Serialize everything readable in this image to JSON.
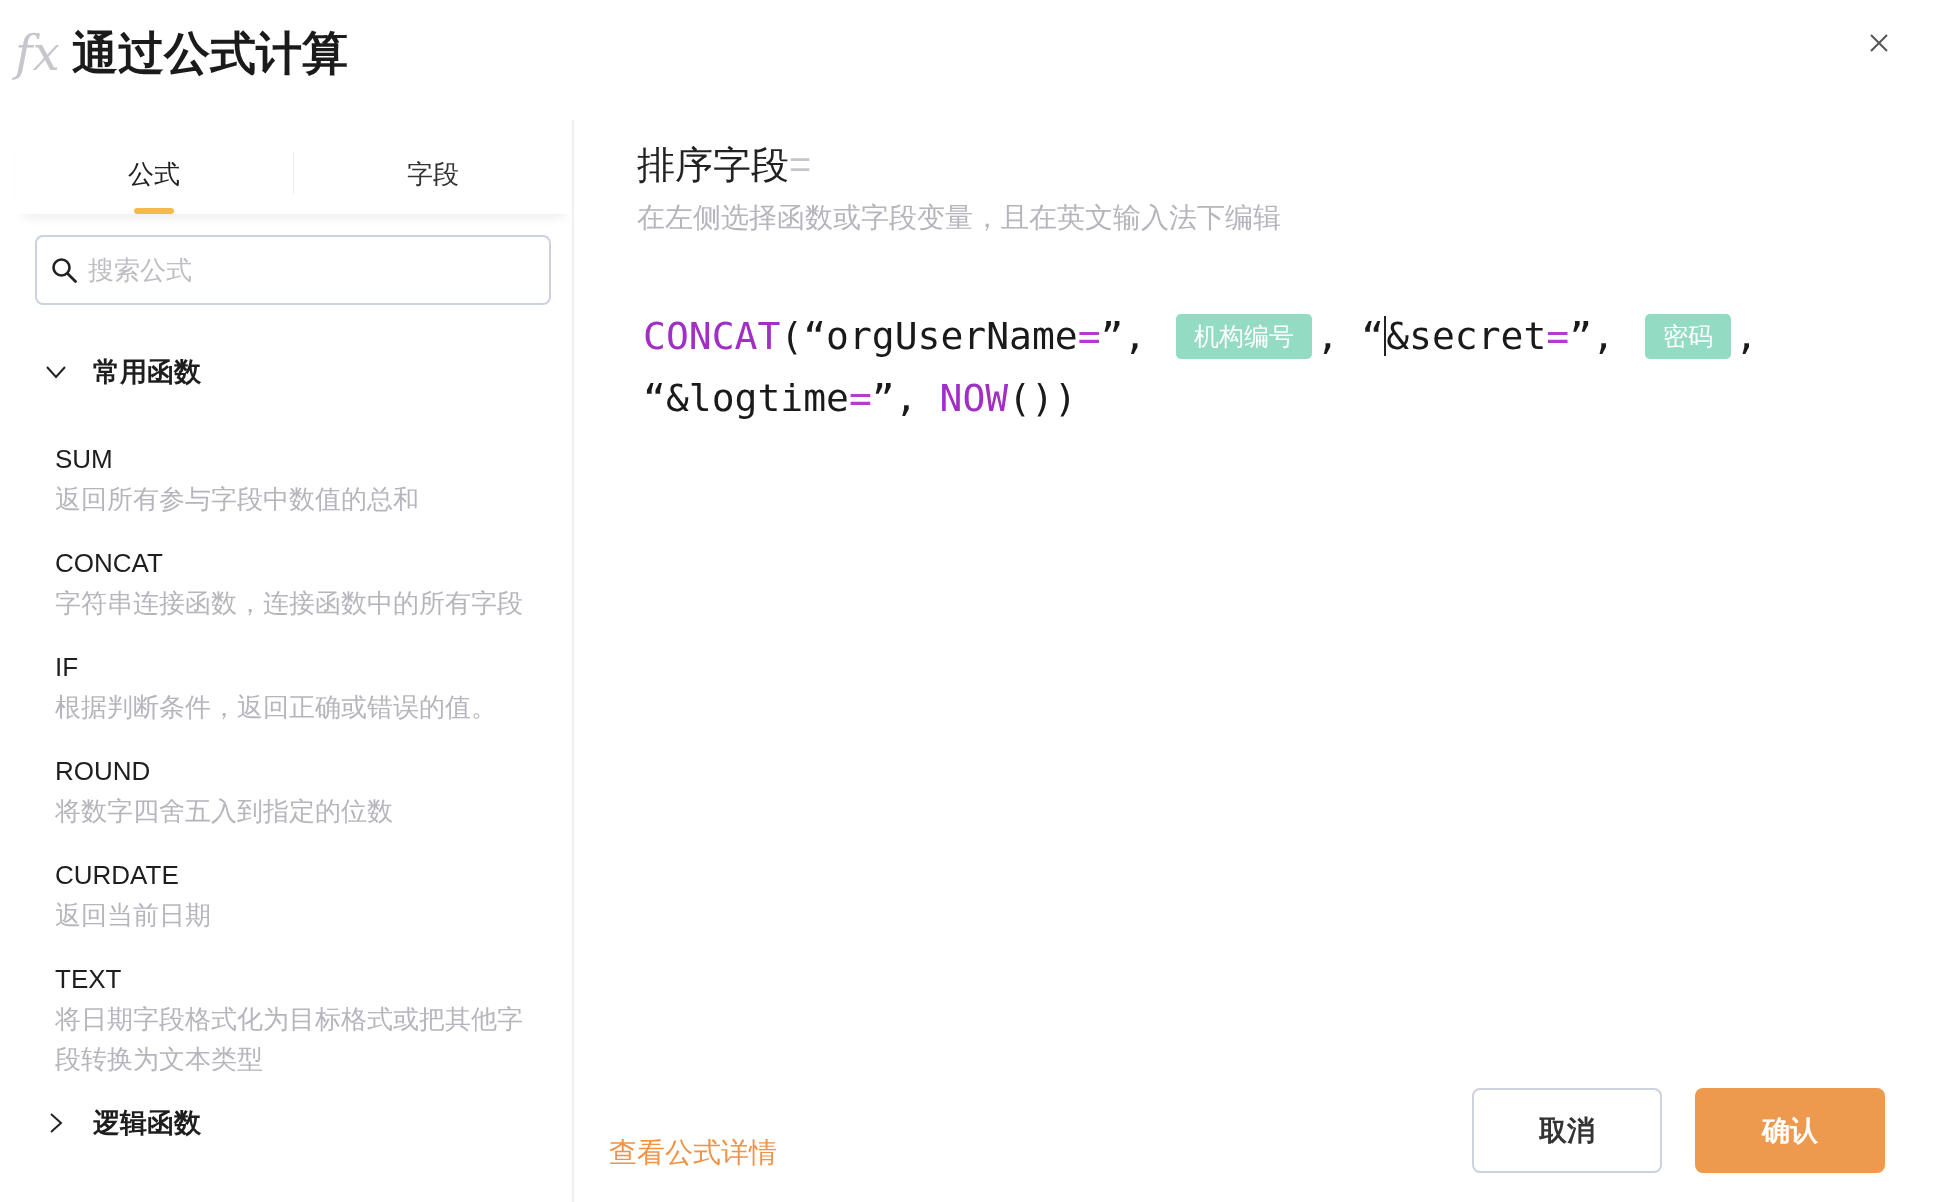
{
  "header": {
    "icon": "fx",
    "title": "通过公式计算"
  },
  "left_panel": {
    "tabs": [
      {
        "label": "公式",
        "selected": true
      },
      {
        "label": "字段",
        "selected": false
      }
    ],
    "search": {
      "placeholder": "搜索公式"
    },
    "groups": [
      {
        "label": "常用函数",
        "expanded": true,
        "items": [
          {
            "name": "SUM",
            "description": "返回所有参与字段中数值的总和"
          },
          {
            "name": "CONCAT",
            "description": "字符串连接函数，连接函数中的所有字段"
          },
          {
            "name": "IF",
            "description": "根据判断条件，返回正确或错误的值。"
          },
          {
            "name": "ROUND",
            "description": "将数字四舍五入到指定的位数"
          },
          {
            "name": "CURDATE",
            "description": "返回当前日期"
          },
          {
            "name": "TEXT",
            "description": "将日期字段格式化为目标格式或把其他字段转换为文本类型"
          }
        ]
      },
      {
        "label": "逻辑函数",
        "expanded": false
      }
    ]
  },
  "editor": {
    "field_name": "排序字段",
    "equals": "=",
    "hint": "在左侧选择函数或字段变量，且在英文输入法下编辑",
    "lines": [
      [
        {
          "kind": "code",
          "parts": [
            {
              "kind": "function",
              "text": "CONCAT"
            },
            {
              "kind": "plain",
              "text": "(“orgUserName"
            },
            {
              "kind": "operator",
              "text": "="
            },
            {
              "kind": "plain",
              "text": "”,"
            }
          ]
        },
        {
          "kind": "tag",
          "text": "机构编号"
        },
        {
          "kind": "code",
          "parts": [
            {
              "kind": "plain",
              "text": ","
            }
          ]
        },
        {
          "kind": "code",
          "parts": [
            {
              "kind": "plain",
              "text": "“"
            }
          ]
        },
        {
          "kind": "cursor"
        },
        {
          "kind": "code",
          "parts": [
            {
              "kind": "plain",
              "text": "&secret"
            },
            {
              "kind": "operator",
              "text": "="
            },
            {
              "kind": "plain",
              "text": "”,"
            }
          ]
        },
        {
          "kind": "tag",
          "text": "密码"
        },
        {
          "kind": "code",
          "parts": [
            {
              "kind": "plain",
              "text": ","
            }
          ]
        }
      ],
      [
        {
          "kind": "code",
          "parts": [
            {
              "kind": "plain",
              "text": "“&logtime"
            },
            {
              "kind": "operator",
              "text": "="
            },
            {
              "kind": "plain",
              "text": "”,"
            }
          ]
        },
        {
          "kind": "code",
          "parts": [
            {
              "kind": "function",
              "text": "NOW"
            },
            {
              "kind": "plain",
              "text": "())"
            }
          ]
        }
      ]
    ]
  },
  "footer": {
    "link": "查看公式详情",
    "buttons": [
      {
        "label": "取消",
        "kind": "secondary"
      },
      {
        "label": "确认",
        "kind": "primary"
      }
    ]
  }
}
